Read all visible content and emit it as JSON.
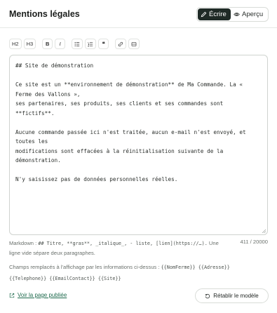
{
  "header": {
    "title": "Mentions légales",
    "write_label": "Écrire",
    "preview_label": "Aperçu"
  },
  "toolbar": {
    "h2": "H2",
    "h3": "H3",
    "bold": "B",
    "italic": "I",
    "quote": "❝"
  },
  "editor": {
    "content": "## Site de démonstration\n\nCe site est un **environnement de démonstration** de Ma Commande. La « Ferme des Vallons »,\nses partenaires, ses produits, ses clients et ses commandes sont **fictifs**.\n\nAucune commande passée ici n'est traitée, aucun e-mail n'est envoyé, et toutes les\nmodifications sont effacées à la réinitialisation suivante de la démonstration.\n\nN'y saisissez pas de données personnelles réelles."
  },
  "help": {
    "prefix": "Markdown : ",
    "syntax": "## Titre, **gras**, _italique_, - liste, [lien](https://…).",
    "suffix": " Une ligne vide sépare deux paragraphes.",
    "count": "411 / 20000"
  },
  "fields": {
    "text": "Champs remplacés à l'affichage par les informations ci-dessus : ",
    "tokens_line1": "{{NomFerme}} {{Adresse}}",
    "tokens_line2": "{{Telephone}} {{EmailContact}} {{Site}}"
  },
  "footer": {
    "view_link": "Voir la page publiée",
    "restore_label": "Rétablir le modèle"
  }
}
